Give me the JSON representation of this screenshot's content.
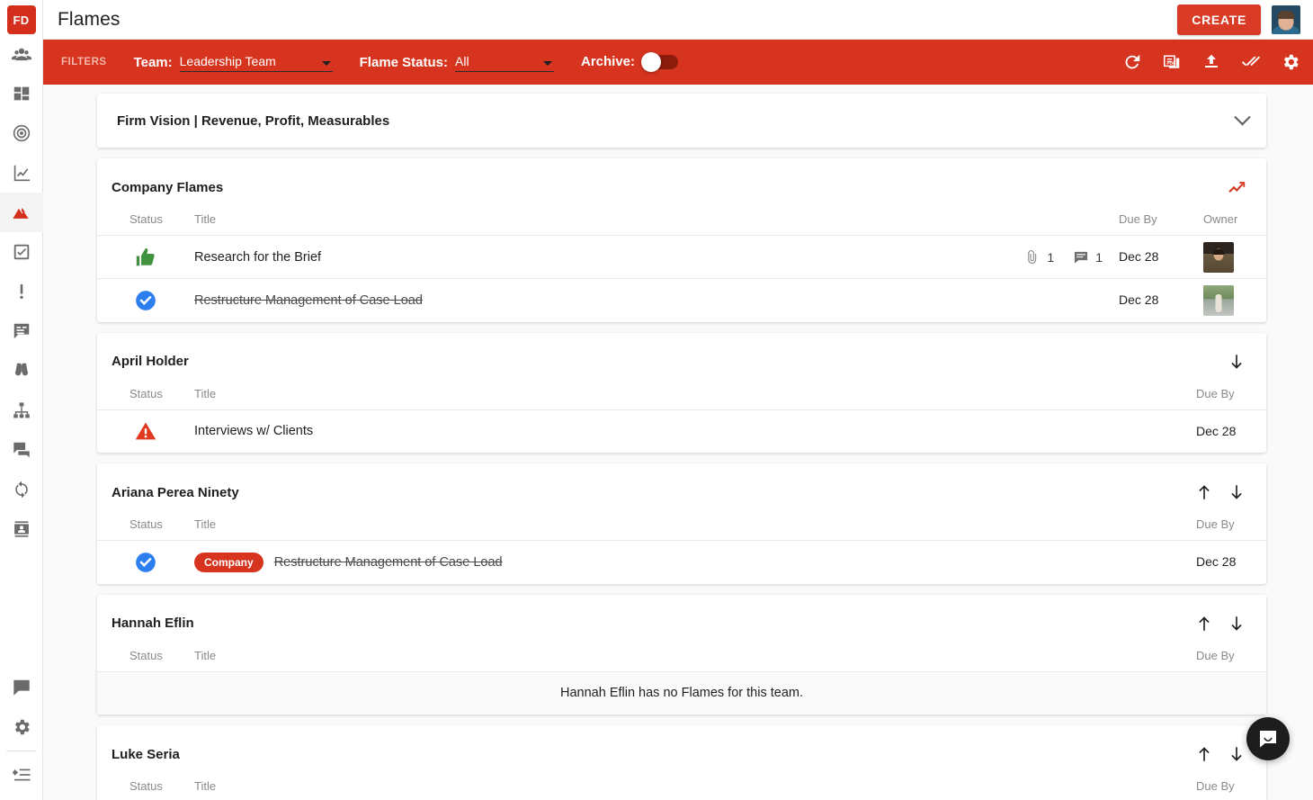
{
  "brand": {
    "logo_text": "FD",
    "accent": "#d6341f",
    "accent_dark": "#8c1c0c"
  },
  "header": {
    "title": "Flames",
    "create_label": "CREATE",
    "avatar_name": "user-avatar"
  },
  "sidebar": {
    "items": [
      {
        "name": "sidebar-item-people",
        "icon": "people-icon"
      },
      {
        "name": "sidebar-item-dashboard",
        "icon": "dashboard-icon"
      },
      {
        "name": "sidebar-item-targets",
        "icon": "target-icon"
      },
      {
        "name": "sidebar-item-metrics",
        "icon": "line-chart-icon"
      },
      {
        "name": "sidebar-item-flames",
        "icon": "mountain-icon",
        "active": true
      },
      {
        "name": "sidebar-item-todos",
        "icon": "checkbox-icon"
      },
      {
        "name": "sidebar-item-issues",
        "icon": "exclamation-icon"
      },
      {
        "name": "sidebar-item-notes",
        "icon": "comment-list-icon"
      },
      {
        "name": "sidebar-item-vision",
        "icon": "binoculars-icon"
      },
      {
        "name": "sidebar-item-accountability",
        "icon": "org-chart-icon"
      },
      {
        "name": "sidebar-item-meetings",
        "icon": "chat-icon"
      },
      {
        "name": "sidebar-item-process",
        "icon": "sync-icon"
      },
      {
        "name": "sidebar-item-directory",
        "icon": "contact-card-icon"
      }
    ],
    "bottom_items": [
      {
        "name": "sidebar-item-feedback",
        "icon": "feedback-icon"
      },
      {
        "name": "sidebar-item-settings",
        "icon": "gear-icon"
      },
      {
        "name": "sidebar-item-collapse",
        "icon": "collapse-icon"
      }
    ]
  },
  "filterbar": {
    "label": "FILTERS",
    "team": {
      "label": "Team:",
      "value": "Leadership Team"
    },
    "flame_status": {
      "label": "Flame Status:",
      "value": "All"
    },
    "archive": {
      "label": "Archive:",
      "enabled": false
    },
    "actions": [
      {
        "name": "refresh-icon",
        "title": "Refresh"
      },
      {
        "name": "pdf-icon",
        "title": "Export PDF"
      },
      {
        "name": "upload-icon",
        "title": "Upload"
      },
      {
        "name": "double-check-icon",
        "title": "Mark Complete"
      },
      {
        "name": "gear-icon",
        "title": "Settings"
      }
    ]
  },
  "vision": {
    "text": "Firm Vision | Revenue, Profit, Measurables"
  },
  "columns": {
    "status": "Status",
    "title": "Title",
    "due_by": "Due By",
    "owner": "Owner"
  },
  "groups": [
    {
      "title": "Company Flames",
      "icon": "trending-up-icon",
      "has_owner": true,
      "controls": [],
      "empty_message": null,
      "rows": [
        {
          "status": "thumbs-up",
          "title": "Research for the Brief",
          "badge": null,
          "completed": false,
          "attachments": "1",
          "comments": "1",
          "due_by": "Dec 28",
          "owner_avatar": "av1"
        },
        {
          "status": "check",
          "title": "Restructure Management of Case Load",
          "badge": null,
          "completed": true,
          "attachments": null,
          "comments": null,
          "due_by": "Dec 28",
          "owner_avatar": "av2"
        }
      ]
    },
    {
      "title": "April Holder",
      "icon": null,
      "has_owner": false,
      "controls": [
        "arrow-down"
      ],
      "empty_message": null,
      "rows": [
        {
          "status": "warning",
          "title": "Interviews w/ Clients",
          "badge": null,
          "completed": false,
          "attachments": null,
          "comments": null,
          "due_by": "Dec 28",
          "owner_avatar": null
        }
      ]
    },
    {
      "title": "Ariana Perea Ninety",
      "icon": null,
      "has_owner": false,
      "controls": [
        "arrow-up",
        "arrow-down"
      ],
      "empty_message": null,
      "rows": [
        {
          "status": "check",
          "title": "Restructure Management of Case Load",
          "badge": "Company",
          "completed": true,
          "attachments": null,
          "comments": null,
          "due_by": "Dec 28",
          "owner_avatar": null
        }
      ]
    },
    {
      "title": "Hannah Eflin",
      "icon": null,
      "has_owner": false,
      "controls": [
        "arrow-up",
        "arrow-down"
      ],
      "empty_message": "Hannah Eflin has no Flames for this team.",
      "rows": []
    },
    {
      "title": "Luke Seria",
      "icon": null,
      "has_owner": false,
      "controls": [
        "arrow-up",
        "arrow-down"
      ],
      "empty_message": null,
      "rows": []
    }
  ],
  "chat_widget": {
    "icon": "chat-bubble-icon"
  }
}
